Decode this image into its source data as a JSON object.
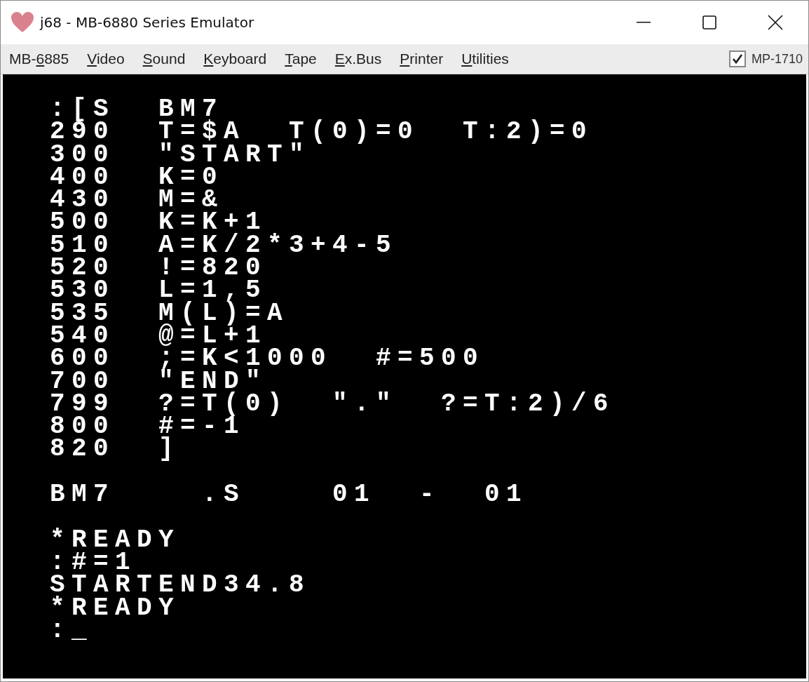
{
  "window": {
    "title": "j68 - MB-6880 Series Emulator"
  },
  "menu": [
    {
      "label_before": "MB-",
      "access_key": "6",
      "label_after": "885"
    },
    {
      "access_key": "V",
      "label_after": "ideo"
    },
    {
      "access_key": "S",
      "label_after": "ound"
    },
    {
      "access_key": "K",
      "label_after": "eyboard"
    },
    {
      "access_key": "T",
      "label_after": "ape"
    },
    {
      "access_key": "E",
      "label_after": "x.Bus"
    },
    {
      "access_key": "P",
      "label_after": "rinter"
    },
    {
      "access_key": "U",
      "label_after": "tilities"
    }
  ],
  "option": {
    "label": "MP-1710",
    "checked": true
  },
  "screen_blocks": [
    [
      ":[S  BM7",
      "290  T=$A  T(0)=0  T:2)=0",
      "300  \"START\"",
      "400  K=0",
      "430  M=&",
      "500  K=K+1",
      "510  A=K/2*3+4-5",
      "520  !=820",
      "530  L=1,5",
      "535  M(L)=A",
      "540  @=L+1",
      "600  ;=K<1000  #=500",
      "700  \"END\"",
      "799  ?=T(0)  \".\"  ?=T:2)/6",
      "800  #=-1",
      "820  ]"
    ],
    [
      "BM7    .S    01  -  01"
    ],
    [
      "*READY",
      ":#=1",
      "STARTEND34.8",
      "*READY",
      ":_"
    ]
  ]
}
